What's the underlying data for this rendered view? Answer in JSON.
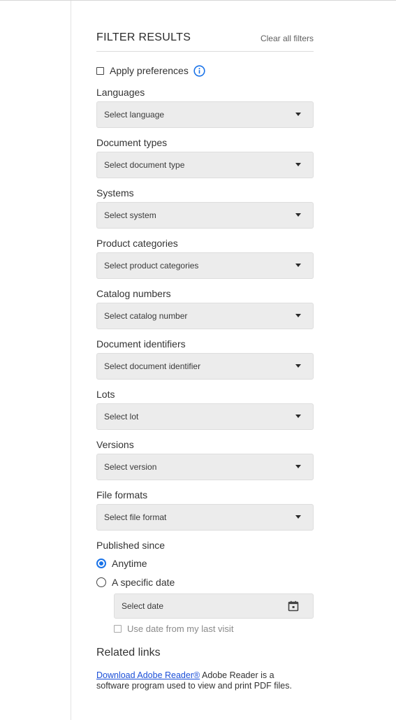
{
  "header": {
    "title": "FILTER RESULTS",
    "clear_all": "Clear all filters"
  },
  "apply_preferences": {
    "label": "Apply preferences"
  },
  "filters": [
    {
      "label": "Languages",
      "placeholder": "Select language"
    },
    {
      "label": "Document types",
      "placeholder": "Select document type"
    },
    {
      "label": "Systems",
      "placeholder": "Select system"
    },
    {
      "label": "Product categories",
      "placeholder": "Select product categories"
    },
    {
      "label": "Catalog numbers",
      "placeholder": "Select catalog number"
    },
    {
      "label": "Document identifiers",
      "placeholder": "Select document identifier"
    },
    {
      "label": "Lots",
      "placeholder": "Select lot"
    },
    {
      "label": "Versions",
      "placeholder": "Select version"
    },
    {
      "label": "File formats",
      "placeholder": "Select file format"
    }
  ],
  "published_since": {
    "label": "Published since",
    "options": [
      "Anytime",
      "A specific date"
    ],
    "selected": "Anytime",
    "date_placeholder": "Select date",
    "last_visit_label": "Use date from my last visit"
  },
  "related": {
    "title": "Related links",
    "link_text": "Download Adobe Reader®",
    "description": " Adobe Reader is a software program used to view and print PDF files."
  },
  "colors": {
    "accent": "#1a73e8",
    "link": "#1b4fd8"
  },
  "icons": {
    "info": "info-icon",
    "dropdown": "caret-down-icon",
    "calendar": "calendar-icon"
  }
}
